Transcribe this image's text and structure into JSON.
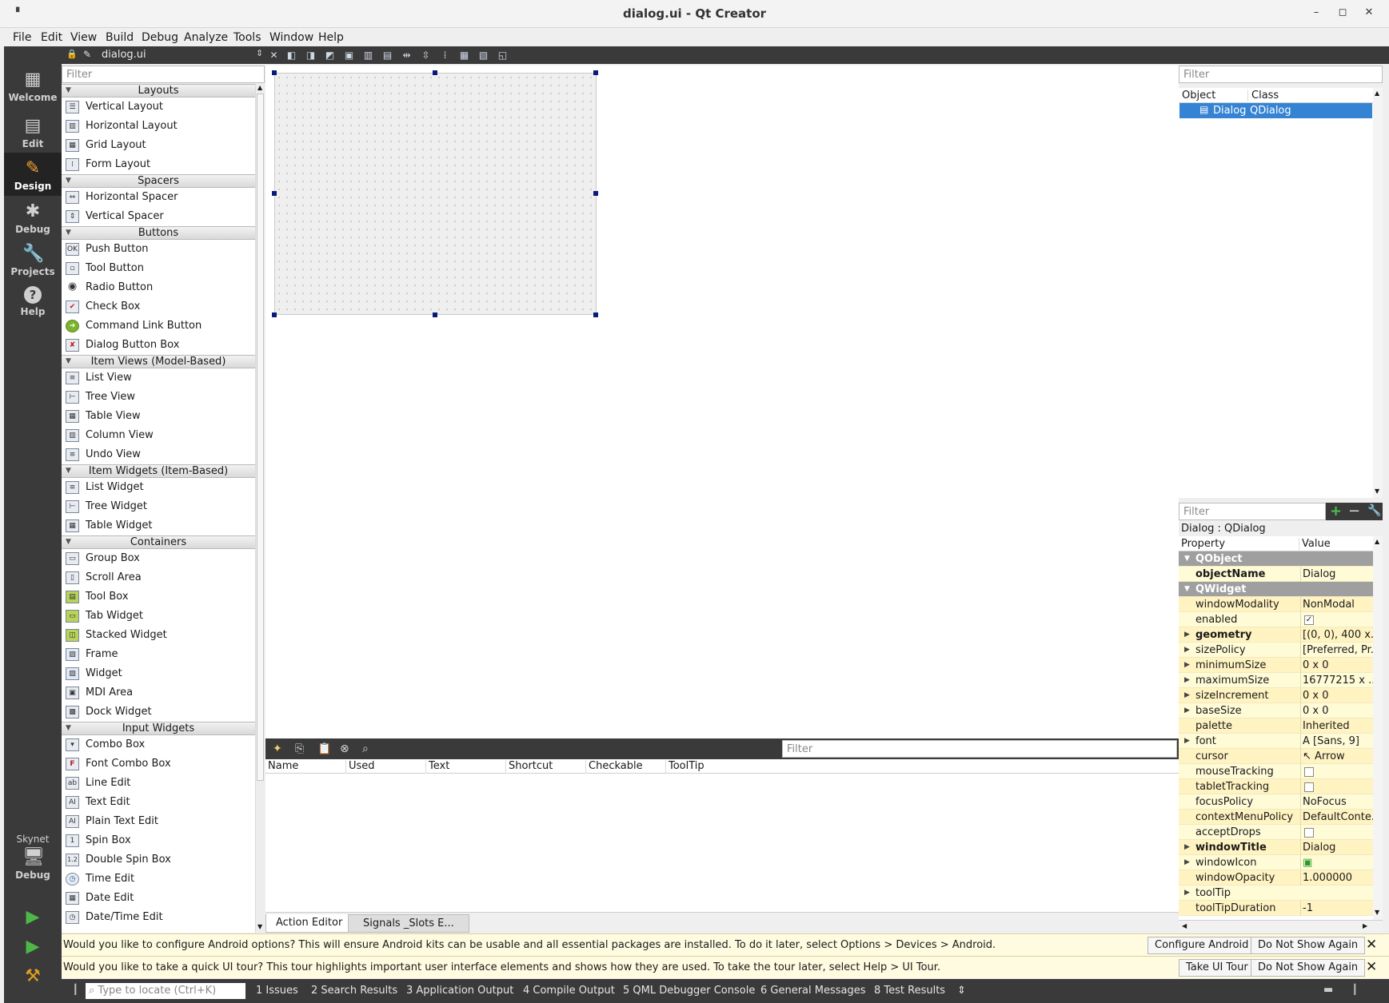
{
  "window": {
    "title": "dialog.ui - Qt Creator",
    "minimize": "–",
    "maximize": "◻",
    "close": "✕"
  },
  "menu": [
    "File",
    "Edit",
    "View",
    "Build",
    "Debug",
    "Analyze",
    "Tools",
    "Window",
    "Help"
  ],
  "modes": [
    {
      "label": "Welcome",
      "icon": "▦"
    },
    {
      "label": "Edit",
      "icon": "▤"
    },
    {
      "label": "Design",
      "icon": "✎"
    },
    {
      "label": "Debug",
      "icon": "✱"
    },
    {
      "label": "Projects",
      "icon": "🔧"
    },
    {
      "label": "Help",
      "icon": "?"
    }
  ],
  "kit": {
    "project": "Skynet",
    "mode": "Debug"
  },
  "editor": {
    "filename": "dialog.ui"
  },
  "widget_box": {
    "filter_placeholder": "Filter",
    "categories": [
      {
        "name": "Layouts",
        "items": [
          "Vertical Layout",
          "Horizontal Layout",
          "Grid Layout",
          "Form Layout"
        ]
      },
      {
        "name": "Spacers",
        "items": [
          "Horizontal Spacer",
          "Vertical Spacer"
        ]
      },
      {
        "name": "Buttons",
        "items": [
          "Push Button",
          "Tool Button",
          "Radio Button",
          "Check Box",
          "Command Link Button",
          "Dialog Button Box"
        ]
      },
      {
        "name": "Item Views (Model-Based)",
        "items": [
          "List View",
          "Tree View",
          "Table View",
          "Column View",
          "Undo View"
        ]
      },
      {
        "name": "Item Widgets (Item-Based)",
        "items": [
          "List Widget",
          "Tree Widget",
          "Table Widget"
        ]
      },
      {
        "name": "Containers",
        "items": [
          "Group Box",
          "Scroll Area",
          "Tool Box",
          "Tab Widget",
          "Stacked Widget",
          "Frame",
          "Widget",
          "MDI Area",
          "Dock Widget"
        ]
      },
      {
        "name": "Input Widgets",
        "items": [
          "Combo Box",
          "Font Combo Box",
          "Line Edit",
          "Text Edit",
          "Plain Text Edit",
          "Spin Box",
          "Double Spin Box",
          "Time Edit",
          "Date Edit",
          "Date/Time Edit"
        ]
      }
    ]
  },
  "action_editor": {
    "filter_placeholder": "Filter",
    "columns": [
      "Name",
      "Used",
      "Text",
      "Shortcut",
      "Checkable",
      "ToolTip"
    ],
    "tabs": [
      "Action Editor",
      "Signals _Slots E..."
    ]
  },
  "object_inspector": {
    "filter_placeholder": "Filter",
    "columns": [
      "Object",
      "Class"
    ],
    "row": {
      "object": "Dialog",
      "class": "QDialog"
    }
  },
  "property_editor": {
    "filter_placeholder": "Filter",
    "title": "Dialog : QDialog",
    "columns": [
      "Property",
      "Value"
    ],
    "rows": [
      {
        "name": "QObject",
        "group": true
      },
      {
        "name": "objectName",
        "value": "Dialog",
        "bold": true
      },
      {
        "name": "QWidget",
        "group": true
      },
      {
        "name": "windowModality",
        "value": "NonModal"
      },
      {
        "name": "enabled",
        "check": true
      },
      {
        "name": "geometry",
        "value": "[(0, 0), 400 x...",
        "bold": true,
        "expand": true
      },
      {
        "name": "sizePolicy",
        "value": "[Preferred, Pr...",
        "expand": true
      },
      {
        "name": "minimumSize",
        "value": "0 x 0",
        "expand": true
      },
      {
        "name": "maximumSize",
        "value": "16777215 x ...",
        "expand": true
      },
      {
        "name": "sizeIncrement",
        "value": "0 x 0",
        "expand": true
      },
      {
        "name": "baseSize",
        "value": "0 x 0",
        "expand": true
      },
      {
        "name": "palette",
        "value": "Inherited"
      },
      {
        "name": "font",
        "value": "A  [Sans, 9]",
        "expand": true
      },
      {
        "name": "cursor",
        "value": "↖  Arrow"
      },
      {
        "name": "mouseTracking",
        "check": false
      },
      {
        "name": "tabletTracking",
        "check": false
      },
      {
        "name": "focusPolicy",
        "value": "NoFocus"
      },
      {
        "name": "contextMenuPolicy",
        "value": "DefaultConte..."
      },
      {
        "name": "acceptDrops",
        "check": false
      },
      {
        "name": "windowTitle",
        "value": "Dialog",
        "bold": true,
        "expand": true
      },
      {
        "name": "windowIcon",
        "value": "▣",
        "expand": true
      },
      {
        "name": "windowOpacity",
        "value": "1.000000"
      },
      {
        "name": "toolTip",
        "value": "",
        "expand": true
      },
      {
        "name": "toolTipDuration",
        "value": "-1"
      }
    ]
  },
  "info_bars": [
    {
      "message": "Would you like to configure Android options? This will ensure Android kits can be usable and all essential packages are installed. To do it later, select Options > Devices > Android.",
      "primary": "Configure Android",
      "secondary": "Do Not Show Again"
    },
    {
      "message": "Would you like to take a quick UI tour? This tour highlights important user interface elements and shows how they are used. To take the tour later, select Help > UI Tour.",
      "primary": "Take UI Tour",
      "secondary": "Do Not Show Again"
    }
  ],
  "status_bar": {
    "locator_placeholder": "Type to locate (Ctrl+K)",
    "panes": [
      "1  Issues",
      "2  Search Results",
      "3  Application Output",
      "4  Compile Output",
      "5  QML Debugger Console",
      "6  General Messages",
      "8  Test Results"
    ]
  }
}
